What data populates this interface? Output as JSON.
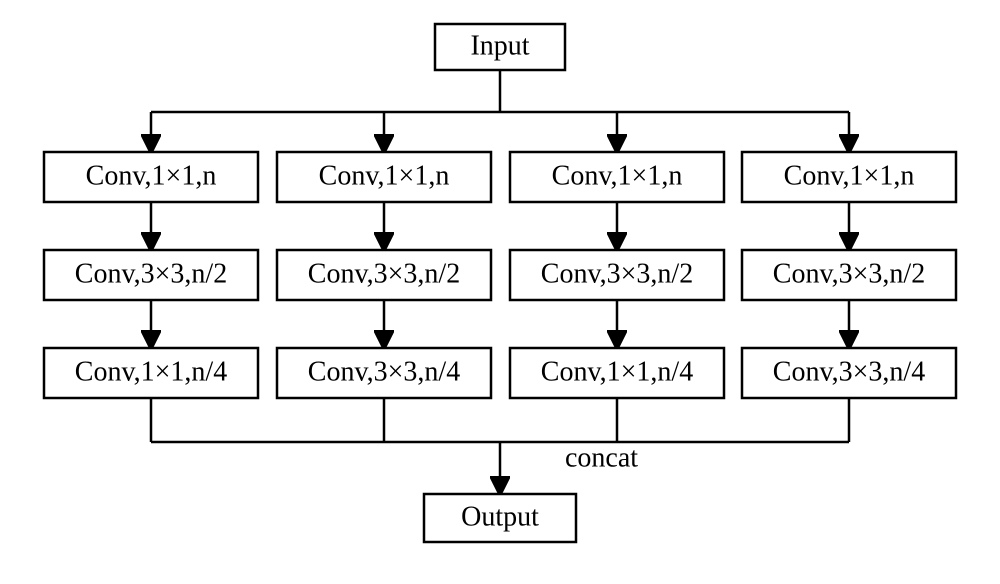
{
  "diagram": {
    "input": "Input",
    "output": "Output",
    "concat_label": "concat",
    "branches": [
      {
        "l1": "Conv,1×1,n",
        "l2": "Conv,3×3,n/2",
        "l3": "Conv,1×1,n/4"
      },
      {
        "l1": "Conv,1×1,n",
        "l2": "Conv,3×3,n/2",
        "l3": "Conv,3×3,n/4"
      },
      {
        "l1": "Conv,1×1,n",
        "l2": "Conv,3×3,n/2",
        "l3": "Conv,1×1,n/4"
      },
      {
        "l1": "Conv,1×1,n",
        "l2": "Conv,3×3,n/2",
        "l3": "Conv,3×3,n/4"
      }
    ]
  }
}
